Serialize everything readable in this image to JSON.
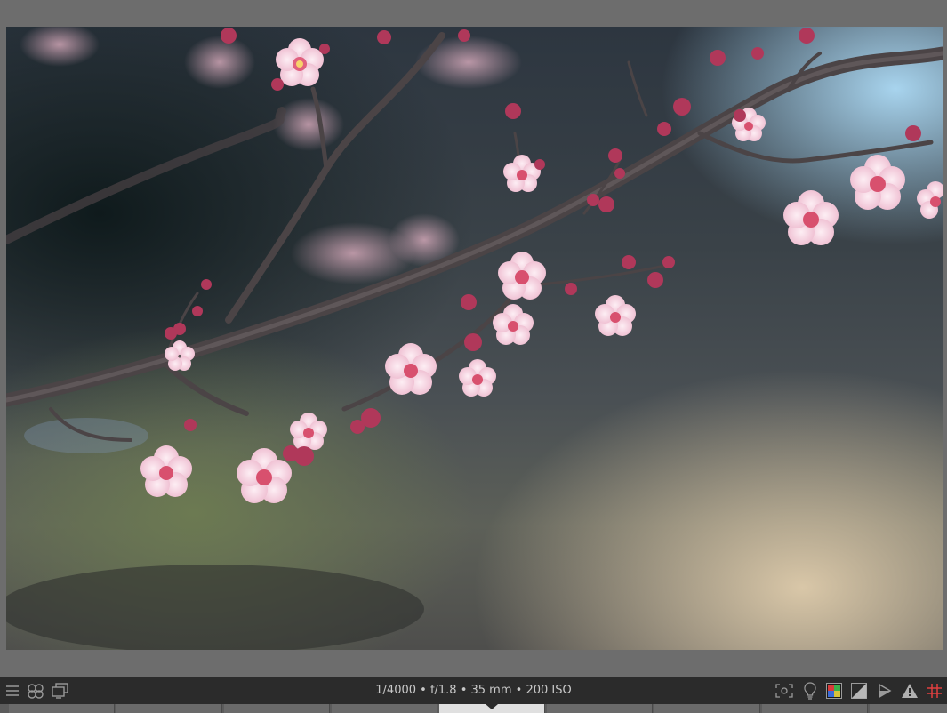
{
  "status_bar": {
    "exif_text": "1/4000 • f/1.8 • 35 mm • 200 ISO",
    "left_tools": [
      "hamburger-menu-icon",
      "color-groups-icon",
      "display-icon"
    ],
    "right_tools": [
      "focus-icon",
      "bulb-icon",
      "color-picker-icon",
      "contrast-icon",
      "play-icon",
      "warning-icon",
      "grid-icon"
    ]
  },
  "photo": {
    "subject": "plum blossoms on branch"
  },
  "colors": {
    "viewer_bg": "#6d6d6d",
    "status_bg": "#2b2b2b",
    "grid_accent": "#e04040",
    "blossom": "#f4d4e0",
    "bud": "#b0385a"
  },
  "filmstrip": {
    "active_index": 4,
    "slots": 9
  }
}
